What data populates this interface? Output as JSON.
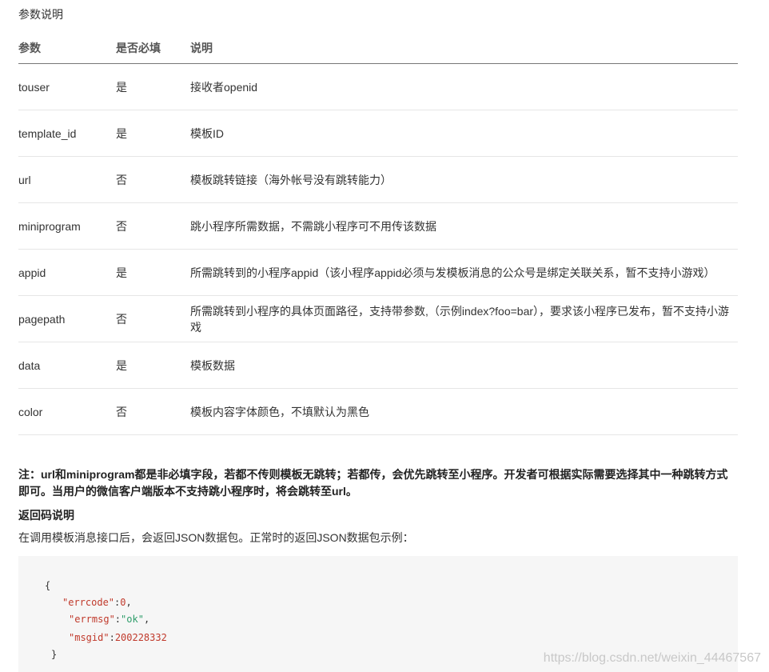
{
  "section_title": "参数说明",
  "table": {
    "headers": [
      "参数",
      "是否必填",
      "说明"
    ],
    "rows": [
      {
        "param": "touser",
        "required": "是",
        "desc": "接收者openid"
      },
      {
        "param": "template_id",
        "required": "是",
        "desc": "模板ID"
      },
      {
        "param": "url",
        "required": "否",
        "desc": "模板跳转链接（海外帐号没有跳转能力）"
      },
      {
        "param": "miniprogram",
        "required": "否",
        "desc": "跳小程序所需数据，不需跳小程序可不用传该数据"
      },
      {
        "param": "appid",
        "required": "是",
        "desc": "所需跳转到的小程序appid（该小程序appid必须与发模板消息的公众号是绑定关联关系，暂不支持小游戏）"
      },
      {
        "param": "pagepath",
        "required": "否",
        "desc": "所需跳转到小程序的具体页面路径，支持带参数,（示例index?foo=bar），要求该小程序已发布，暂不支持小游戏"
      },
      {
        "param": "data",
        "required": "是",
        "desc": "模板数据"
      },
      {
        "param": "color",
        "required": "否",
        "desc": "模板内容字体颜色，不填默认为黑色"
      }
    ]
  },
  "note": "注：url和miniprogram都是非必填字段，若都不传则模板无跳转；若都传，会优先跳转至小程序。开发者可根据实际需要选择其中一种跳转方式即可。当用户的微信客户端版本不支持跳小程序时，将会跳转至url。",
  "return_title": "返回码说明",
  "return_desc": "在调用模板消息接口后，会返回JSON数据包。正常时的返回JSON数据包示例：",
  "code": {
    "open_brace": "{",
    "errcode_key": "\"errcode\"",
    "errcode_val": "0",
    "errmsg_key": "\"errmsg\"",
    "errmsg_val": "\"ok\"",
    "msgid_key": "\"msgid\"",
    "msgid_val": "200228332",
    "close_brace": "}"
  },
  "watermark": "https://blog.csdn.net/weixin_44467567"
}
